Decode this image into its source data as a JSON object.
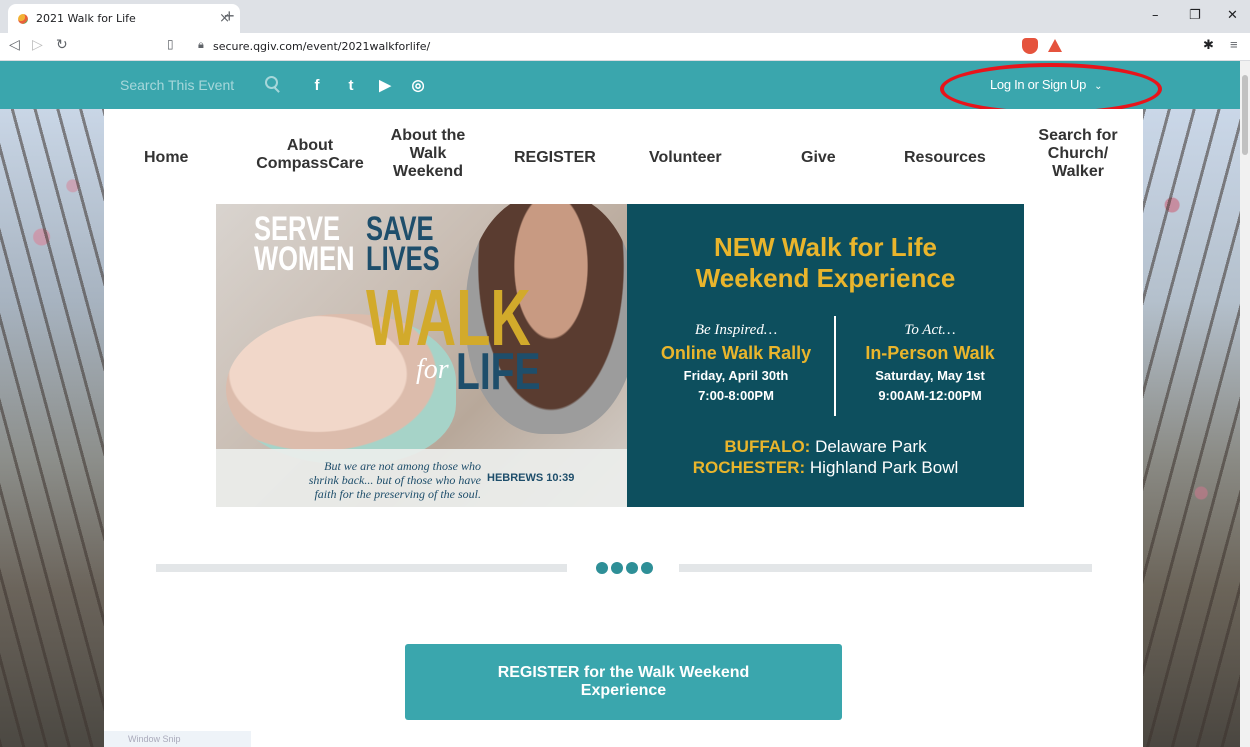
{
  "browser": {
    "tab_title": "2021 Walk for Life",
    "tab_close": "×",
    "new_tab": "+",
    "url": "secure.qgiv.com/event/2021walkforlife/",
    "win_min": "–",
    "win_max": "❐",
    "win_close": "✕"
  },
  "topbar": {
    "search_placeholder": "Search This Event",
    "social": [
      "f",
      "t",
      "▶",
      "◎"
    ],
    "login_label": "Log In or Sign Up"
  },
  "nav": {
    "home": "Home",
    "about1": "About",
    "about2": "CompassCare",
    "walk1": "About the",
    "walk2": "Walk",
    "walk3": "Weekend",
    "register": "REGISTER",
    "volunteer": "Volunteer",
    "give": "Give",
    "resources": "Resources",
    "search1": "Search for",
    "search2": "Church/",
    "search3": "Walker"
  },
  "hero": {
    "serve_line1": "SERVE",
    "serve_line2": "WOMEN",
    "save_line1": "SAVE",
    "save_line2": "LIVES",
    "walk": "WALK",
    "for": "for",
    "life": "LIFE",
    "quote_line1": "But we are not among those who",
    "quote_line2": "shrink back... but of those who have",
    "quote_line3": "faith for the preserving of the soul.",
    "verse": "HEBREWS 10:39",
    "title_line1": "NEW Walk for Life",
    "title_line2": "Weekend Experience",
    "left_sub": "Be Inspired…",
    "left_event": "Online Walk Rally",
    "left_date": "Friday, April 30th",
    "left_time": "7:00-8:00PM",
    "right_sub": "To Act…",
    "right_event": "In-Person Walk",
    "right_date": "Saturday, May 1st",
    "right_time": "9:00AM-12:00PM",
    "loc1_city": "BUFFALO:",
    "loc1_place": "Delaware Park",
    "loc2_city": "ROCHESTER:",
    "loc2_place": "Highland Park Bowl"
  },
  "cta_label": "REGISTER for the Walk Weekend Experience",
  "snip_label": "Window Snip",
  "colors": {
    "teal": "#3aa6ad",
    "navy": "#0d4f5e",
    "gold": "#e9b52c",
    "highlight": "#e8141b"
  }
}
